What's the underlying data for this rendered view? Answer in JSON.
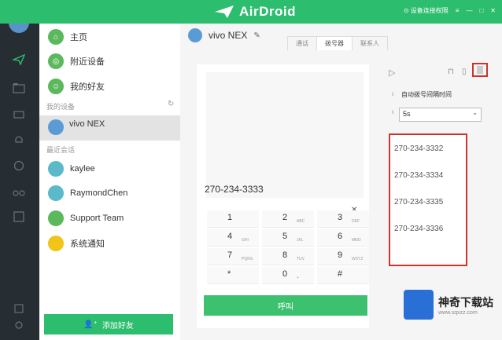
{
  "app": {
    "title": "AirDroid",
    "title_right_label": "设备连接权限"
  },
  "sidebar": {
    "nav": [
      {
        "label": "主页",
        "icon": "home-icon"
      },
      {
        "label": "附近设备",
        "icon": "compass-icon"
      },
      {
        "label": "我的好友",
        "icon": "friends-icon"
      }
    ],
    "my_devices_label": "我的设备",
    "device": {
      "name": "vivo NEX"
    },
    "recent_label": "最近会话",
    "contacts": [
      {
        "name": "kaylee"
      },
      {
        "name": "RaymondChen"
      },
      {
        "name": "Support Team"
      },
      {
        "name": "系统通知"
      }
    ],
    "add_friend_label": "添加好友"
  },
  "main": {
    "device_name": "vivo NEX",
    "tabs": [
      "通话",
      "拨号器",
      "联系人"
    ],
    "active_tab": 1,
    "dialer": {
      "number": "270-234-3333",
      "keys": [
        {
          "num": "1",
          "letters": ""
        },
        {
          "num": "2",
          "letters": "ABC"
        },
        {
          "num": "3",
          "letters": "DEF"
        },
        {
          "num": "4",
          "letters": "GHI"
        },
        {
          "num": "5",
          "letters": "JKL"
        },
        {
          "num": "6",
          "letters": "MNO"
        },
        {
          "num": "7",
          "letters": "PQRS"
        },
        {
          "num": "8",
          "letters": "TUV"
        },
        {
          "num": "9",
          "letters": "WXYZ"
        },
        {
          "num": "*",
          "letters": ""
        },
        {
          "num": "0",
          "letters": "+"
        },
        {
          "num": "#",
          "letters": ""
        }
      ],
      "call_label": "呼叫"
    },
    "auto_dial": {
      "interval_label": "自动拨号间隔时间",
      "interval_value": "5s",
      "numbers": [
        "270-234-3332",
        "270-234-3334",
        "270-234-3335",
        "270-234-3336"
      ]
    }
  },
  "watermark": {
    "title": "神奇下载站",
    "url": "www.sqxzz.com"
  }
}
